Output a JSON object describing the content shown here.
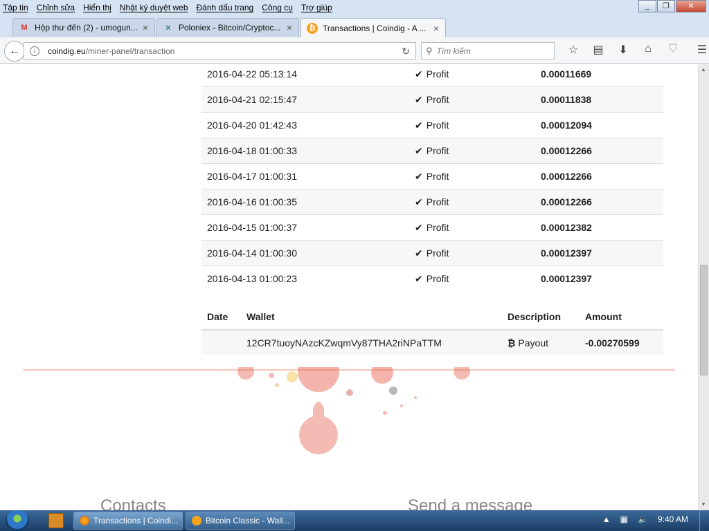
{
  "menu": [
    "Tập tin",
    "Chỉnh sửa",
    "Hiển thị",
    "Nhật ký duyệt web",
    "Đánh dấu trang",
    "Công cụ",
    "Trợ giúp"
  ],
  "tabs": [
    {
      "label": "Hộp thư đến (2) - umogun...",
      "icon": "gmail-icon"
    },
    {
      "label": "Poloniex - Bitcoin/Cryptoc...",
      "icon": "poloniex-icon"
    },
    {
      "label": "Transactions | Coindig - A ...",
      "icon": "bitcoin-icon"
    }
  ],
  "address": {
    "host": "coindig.eu",
    "path": "/miner-panel/transaction"
  },
  "search": {
    "placeholder": "Tìm kiếm"
  },
  "profit_rows": [
    {
      "date": "2016-04-22 05:13:14",
      "type": "Profit",
      "amount": "0.00011669"
    },
    {
      "date": "2016-04-21 02:15:47",
      "type": "Profit",
      "amount": "0.00011838"
    },
    {
      "date": "2016-04-20 01:42:43",
      "type": "Profit",
      "amount": "0.00012094"
    },
    {
      "date": "2016-04-18 01:00:33",
      "type": "Profit",
      "amount": "0.00012266"
    },
    {
      "date": "2016-04-17 01:00:31",
      "type": "Profit",
      "amount": "0.00012266"
    },
    {
      "date": "2016-04-16 01:00:35",
      "type": "Profit",
      "amount": "0.00012266"
    },
    {
      "date": "2016-04-15 01:00:37",
      "type": "Profit",
      "amount": "0.00012382"
    },
    {
      "date": "2016-04-14 01:00:30",
      "type": "Profit",
      "amount": "0.00012397"
    },
    {
      "date": "2016-04-13 01:00:23",
      "type": "Profit",
      "amount": "0.00012397"
    }
  ],
  "payout_table": {
    "headers": [
      "Date",
      "Wallet",
      "Description",
      "Amount"
    ],
    "rows": [
      {
        "date": "",
        "wallet": "12CR7tuoyNAzcKZwqmVy87THA2riNPaTTM",
        "description": "Payout",
        "amount": "-0.00270599"
      }
    ]
  },
  "footer": {
    "contacts": "Contacts",
    "send_message": "Send a message"
  },
  "taskbar": {
    "items": [
      {
        "label": "Transactions | Coindi..."
      },
      {
        "label": "Bitcoin Classic - Wall..."
      }
    ],
    "clock": "9:40 AM"
  },
  "colors": {
    "accent_divider": "#f4c7b8",
    "taskbar": "#1d3f66"
  }
}
